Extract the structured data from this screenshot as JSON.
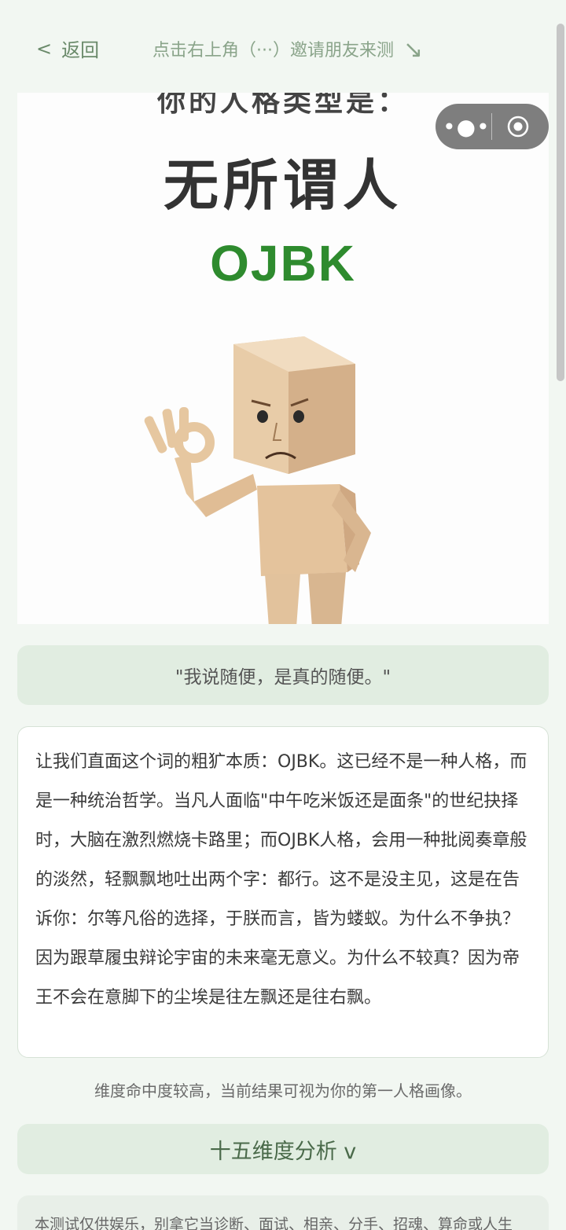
{
  "nav": {
    "back_label": "返回",
    "back_chevron": "<",
    "hint": "点击右上角（···）邀请朋友来测",
    "hint_arrow": "↘"
  },
  "capsule": {
    "more_glyph": "•●•",
    "icons": [
      "more-icon",
      "target-icon"
    ]
  },
  "result": {
    "partial_heading": "你的人格类型是：",
    "type_name": "无所谓人",
    "type_code": "OJBK",
    "code_color": "#2e8b2e"
  },
  "quote": "\"我说随便，是真的随便。\"",
  "description": "让我们直面这个词的粗犷本质：OJBK。这已经不是一种人格，而是一种统治哲学。当凡人面临\"中午吃米饭还是面条\"的世纪抉择时，大脑在激烈燃烧卡路里；而OJBK人格，会用一种批阅奏章般的淡然，轻飘飘地吐出两个字：都行。这不是没主见，这是在告诉你：尔等凡俗的选择，于朕而言，皆为蝼蚁。为什么不争执？因为跟草履虫辩论宇宙的未来毫无意义。为什么不较真？因为帝王不会在意脚下的尘埃是往左飘还是往右飘。",
  "confidence_note": "维度命中度较高，当前结果可视为你的第一人格画像。",
  "dimension_button": "十五维度分析 v",
  "disclaimer": "本测试仅供娱乐，别拿它当诊断、面试、相亲、分手、招魂、算命或人生",
  "colors": {
    "background": "#f2f7f2",
    "card_green": "#e1ede1",
    "accent_green": "#2e8b2e"
  }
}
